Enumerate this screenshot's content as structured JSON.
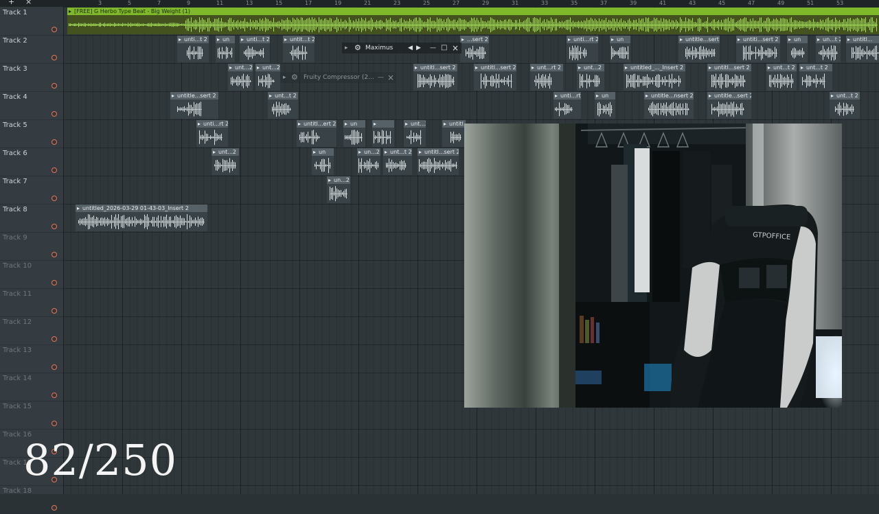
{
  "toolbar": {
    "add_icon": "+",
    "close_icon": "×"
  },
  "ruler": {
    "bars": [
      "3",
      "5",
      "7",
      "9",
      "11",
      "13",
      "15",
      "17",
      "19",
      "21",
      "23",
      "25",
      "27",
      "29",
      "31",
      "33",
      "35",
      "37",
      "39",
      "41",
      "43",
      "45",
      "47",
      "49",
      "51",
      "53"
    ]
  },
  "tracks": [
    "Track 1",
    "Track 2",
    "Track 3",
    "Track 4",
    "Track 5",
    "Track 6",
    "Track 7",
    "Track 8",
    "Track 9",
    "Track 10",
    "Track 11",
    "Track 12",
    "Track 13",
    "Track 14",
    "Track 15",
    "Track 16",
    "Track 17",
    "Track 18"
  ],
  "clips": {
    "master": "[FREE] G Herbo Type Beat - Big Weight (1)",
    "t8_long": "untitled_2026-03-29 01-43-03_Insert 2",
    "c_unti_t2": "unti...t 2",
    "c_un": "un",
    "c_unti_t_2": "unti...t 2",
    "c_untit_t2": "untit...t 2",
    "c_sert2": "...sert 2",
    "c_unti_rt2": "unti...rt 2",
    "c_untitle_sert2": "untitle...sert 2",
    "c_untiti_sert2": "untiti...sert 2",
    "c_untitl_sert2": "untitl...sert 2",
    "c_un_t2": "un...t 2",
    "c_unt_2": "unt...2",
    "c_unt_t2": "unt...t 2",
    "c_unt_rt2": "unt...rt 2",
    "c_untitled_insert2": "untitled_..._Insert 2",
    "c_untitl_ert2": "untitl...ert 2",
    "c_untitle_nsert2": "untitle...nsert 2",
    "c_unt_2b": "unt...2",
    "c_un_2": "un...2",
    "c_untitle_sert2b": "untitle...sert 2",
    "c_untitl": "untitl..."
  },
  "plugin_windows": {
    "maximus": {
      "title": "Maximus",
      "close_icon": "×"
    },
    "compressor": {
      "title": "Fruity Compressor (2...",
      "close_icon": "×"
    }
  },
  "overlay": {
    "counter": "82/250"
  },
  "colors": {
    "accent_green": "#7fb82a",
    "mute_ring": "#e0795d",
    "clip_header": "#566067"
  },
  "icons": [
    "add-icon",
    "close-icon",
    "gear-icon",
    "arrow-left-icon",
    "arrow-right-icon",
    "minimize-icon",
    "maximize-icon",
    "clip-play-icon"
  ]
}
